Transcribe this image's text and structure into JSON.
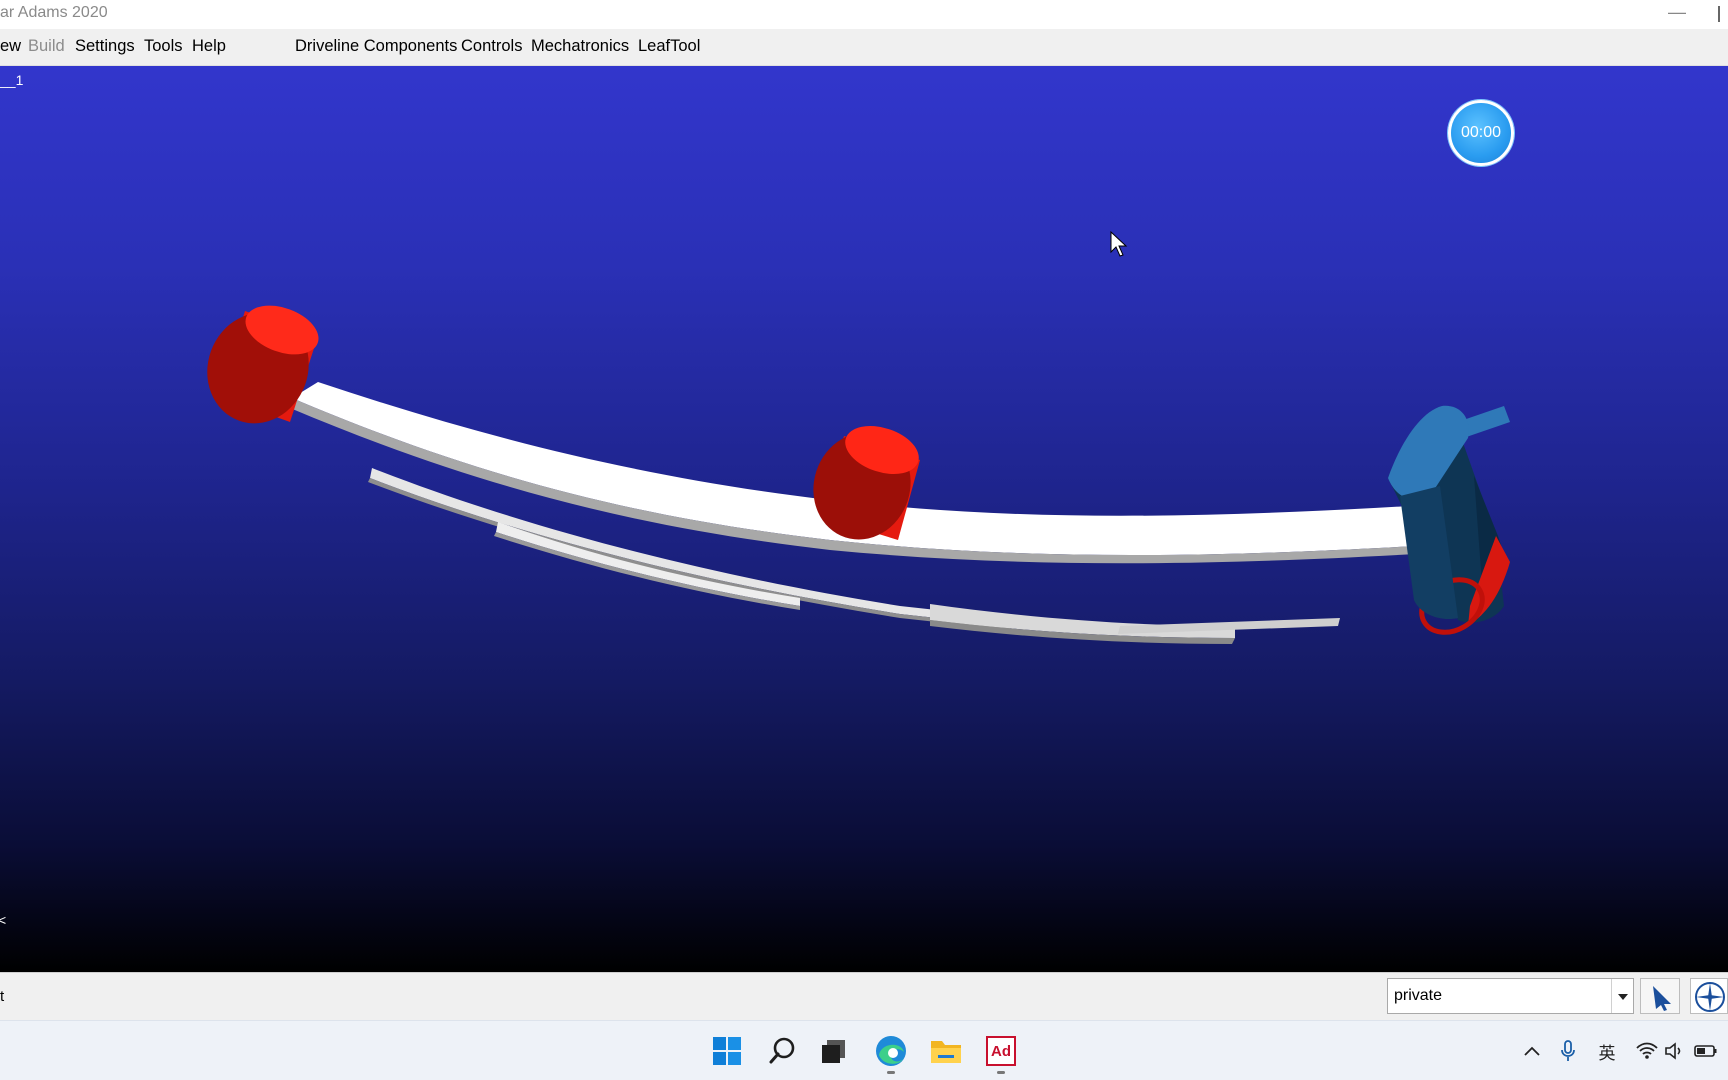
{
  "window": {
    "title": "ar Adams 2020",
    "minimize_glyph": "—"
  },
  "menubar": {
    "items": [
      {
        "label": "ew",
        "enabled": true
      },
      {
        "label": "Build",
        "enabled": false
      },
      {
        "label": "Settings",
        "enabled": true
      },
      {
        "label": "Tools",
        "enabled": true
      },
      {
        "label": "Help",
        "enabled": true
      },
      {
        "label": "Driveline Components",
        "enabled": true
      },
      {
        "label": "Controls",
        "enabled": true
      },
      {
        "label": "Mechatronics",
        "enabled": true
      },
      {
        "label": "LeafTool",
        "enabled": true
      }
    ]
  },
  "viewport": {
    "model_label": "__1",
    "axis_tick": "<",
    "timer": "00:00",
    "colors": {
      "background_top": "#3236cc",
      "background_bottom": "#000000",
      "bushing_red": "#e51a0f",
      "shackle_blue": "#2f79b8",
      "leaf_white": "#ffffff"
    }
  },
  "statusbar": {
    "message": "t",
    "database_value": "private"
  },
  "taskbar": {
    "icons": [
      "windows-start-icon",
      "search-icon",
      "task-view-icon",
      "edge-browser-icon",
      "file-explorer-icon",
      "adams-app-icon"
    ],
    "adams_label": "Ad",
    "ime_label": "英"
  }
}
